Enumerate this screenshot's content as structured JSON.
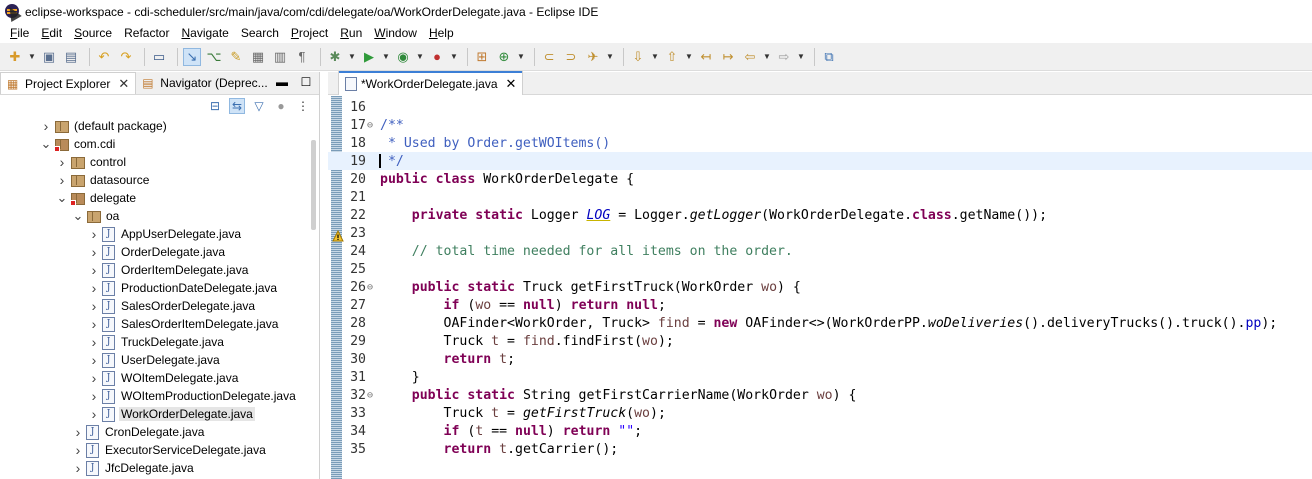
{
  "window": {
    "title": "eclipse-workspace - cdi-scheduler/src/main/java/com/cdi/delegate/oa/WorkOrderDelegate.java - Eclipse IDE"
  },
  "menu": [
    {
      "label": "File",
      "mnemonic": "F",
      "rest": "ile"
    },
    {
      "label": "Edit",
      "mnemonic": "E",
      "rest": "dit"
    },
    {
      "label": "Source",
      "mnemonic": "S",
      "rest": "ource"
    },
    {
      "label": "Refactor",
      "mnemonic": "",
      "rest": "Refactor"
    },
    {
      "label": "Navigate",
      "mnemonic": "N",
      "rest": "avigate"
    },
    {
      "label": "Search",
      "mnemonic": "",
      "rest": "Search"
    },
    {
      "label": "Project",
      "mnemonic": "P",
      "rest": "roject"
    },
    {
      "label": "Run",
      "mnemonic": "R",
      "rest": "un"
    },
    {
      "label": "Window",
      "mnemonic": "W",
      "rest": "indow"
    },
    {
      "label": "Help",
      "mnemonic": "H",
      "rest": "elp"
    }
  ],
  "left_panel": {
    "tabs": [
      {
        "label": "Project Explorer",
        "active": true
      },
      {
        "label": "Navigator (Deprec...",
        "active": false
      }
    ],
    "tree": [
      {
        "label": "(default package)",
        "kind": "package",
        "depth": 1,
        "expanded": false
      },
      {
        "label": "com.cdi",
        "kind": "package-error",
        "depth": 1,
        "expanded": true
      },
      {
        "label": "control",
        "kind": "package",
        "depth": 2,
        "expanded": false
      },
      {
        "label": "datasource",
        "kind": "package",
        "depth": 2,
        "expanded": false
      },
      {
        "label": "delegate",
        "kind": "package-error",
        "depth": 2,
        "expanded": true
      },
      {
        "label": "oa",
        "kind": "package",
        "depth": 3,
        "expanded": true
      },
      {
        "label": "AppUserDelegate.java",
        "kind": "java",
        "depth": 4,
        "expanded": false
      },
      {
        "label": "OrderDelegate.java",
        "kind": "java",
        "depth": 4,
        "expanded": false
      },
      {
        "label": "OrderItemDelegate.java",
        "kind": "java",
        "depth": 4,
        "expanded": false
      },
      {
        "label": "ProductionDateDelegate.java",
        "kind": "java",
        "depth": 4,
        "expanded": false
      },
      {
        "label": "SalesOrderDelegate.java",
        "kind": "java",
        "depth": 4,
        "expanded": false
      },
      {
        "label": "SalesOrderItemDelegate.java",
        "kind": "java",
        "depth": 4,
        "expanded": false
      },
      {
        "label": "TruckDelegate.java",
        "kind": "java",
        "depth": 4,
        "expanded": false
      },
      {
        "label": "UserDelegate.java",
        "kind": "java",
        "depth": 4,
        "expanded": false
      },
      {
        "label": "WOItemDelegate.java",
        "kind": "java",
        "depth": 4,
        "expanded": false
      },
      {
        "label": "WOItemProductionDelegate.java",
        "kind": "java",
        "depth": 4,
        "expanded": false
      },
      {
        "label": "WorkOrderDelegate.java",
        "kind": "java",
        "depth": 4,
        "expanded": false,
        "selected": true
      },
      {
        "label": "CronDelegate.java",
        "kind": "java",
        "depth": 3,
        "expanded": false
      },
      {
        "label": "ExecutorServiceDelegate.java",
        "kind": "java",
        "depth": 3,
        "expanded": false
      },
      {
        "label": "JfcDelegate.java",
        "kind": "java",
        "depth": 3,
        "expanded": false
      }
    ]
  },
  "editor": {
    "tab_label": "*WorkOrderDelegate.java",
    "lines": [
      {
        "n": "16",
        "fold": "",
        "html": ""
      },
      {
        "n": "17",
        "fold": "⊖",
        "html": "<span class=\"jd\">/**</span>"
      },
      {
        "n": "18",
        "fold": "",
        "html": "<span class=\"jd\"> * Used by Order.getWOItems()</span>"
      },
      {
        "n": "19",
        "fold": "",
        "html": "<span class=\"jd\"> */</span>",
        "current": true
      },
      {
        "n": "20",
        "fold": "",
        "html": "<span class=\"kw\">public</span> <span class=\"kw\">class</span> WorkOrderDelegate {"
      },
      {
        "n": "21",
        "fold": "",
        "html": ""
      },
      {
        "n": "22",
        "fold": "",
        "html": "    <span class=\"kw\">private</span> <span class=\"kw\">static</span> Logger <span class=\"fld-static und\">LOG</span> = Logger.<span class=\"static-call\">getLogger</span>(WorkOrderDelegate.<span class=\"kw\">class</span>.getName());"
      },
      {
        "n": "23",
        "fold": "",
        "html": ""
      },
      {
        "n": "24",
        "fold": "",
        "html": "    <span class=\"cm\">// total time needed for all items on the order.</span>"
      },
      {
        "n": "25",
        "fold": "",
        "html": ""
      },
      {
        "n": "26",
        "fold": "⊖",
        "html": "    <span class=\"kw\">public</span> <span class=\"kw\">static</span> Truck getFirstTruck(WorkOrder <span class=\"var\">wo</span>) {"
      },
      {
        "n": "27",
        "fold": "",
        "html": "        <span class=\"kw\">if</span> (<span class=\"var\">wo</span> == <span class=\"kw\">null</span>) <span class=\"kw\">return</span> <span class=\"kw\">null</span>;"
      },
      {
        "n": "28",
        "fold": "",
        "html": "        OAFinder&lt;WorkOrder, Truck&gt; <span class=\"var\">find</span> = <span class=\"kw\">new</span> OAFinder&lt;&gt;(WorkOrderPP.<span class=\"static-call\">woDeliveries</span>().deliveryTrucks().truck().<span class=\"fld\">pp</span>);"
      },
      {
        "n": "29",
        "fold": "",
        "html": "        Truck <span class=\"var\">t</span> = <span class=\"var\">find</span>.findFirst(<span class=\"var\">wo</span>);"
      },
      {
        "n": "30",
        "fold": "",
        "html": "        <span class=\"kw\">return</span> <span class=\"var\">t</span>;"
      },
      {
        "n": "31",
        "fold": "",
        "html": "    }"
      },
      {
        "n": "32",
        "fold": "⊖",
        "html": "    <span class=\"kw\">public</span> <span class=\"kw\">static</span> String getFirstCarrierName(WorkOrder <span class=\"var\">wo</span>) {"
      },
      {
        "n": "33",
        "fold": "",
        "html": "        Truck <span class=\"var\">t</span> = <span class=\"static-call\">getFirstTruck</span>(<span class=\"var\">wo</span>);"
      },
      {
        "n": "34",
        "fold": "",
        "html": "        <span class=\"kw\">if</span> (<span class=\"var\">t</span> == <span class=\"kw\">null</span>) <span class=\"kw\">return</span> <span class=\"str\">\"\"</span>;"
      },
      {
        "n": "35",
        "fold": "",
        "html": "        <span class=\"kw\">return</span> <span class=\"var\">t</span>.getCarrier();"
      }
    ]
  }
}
